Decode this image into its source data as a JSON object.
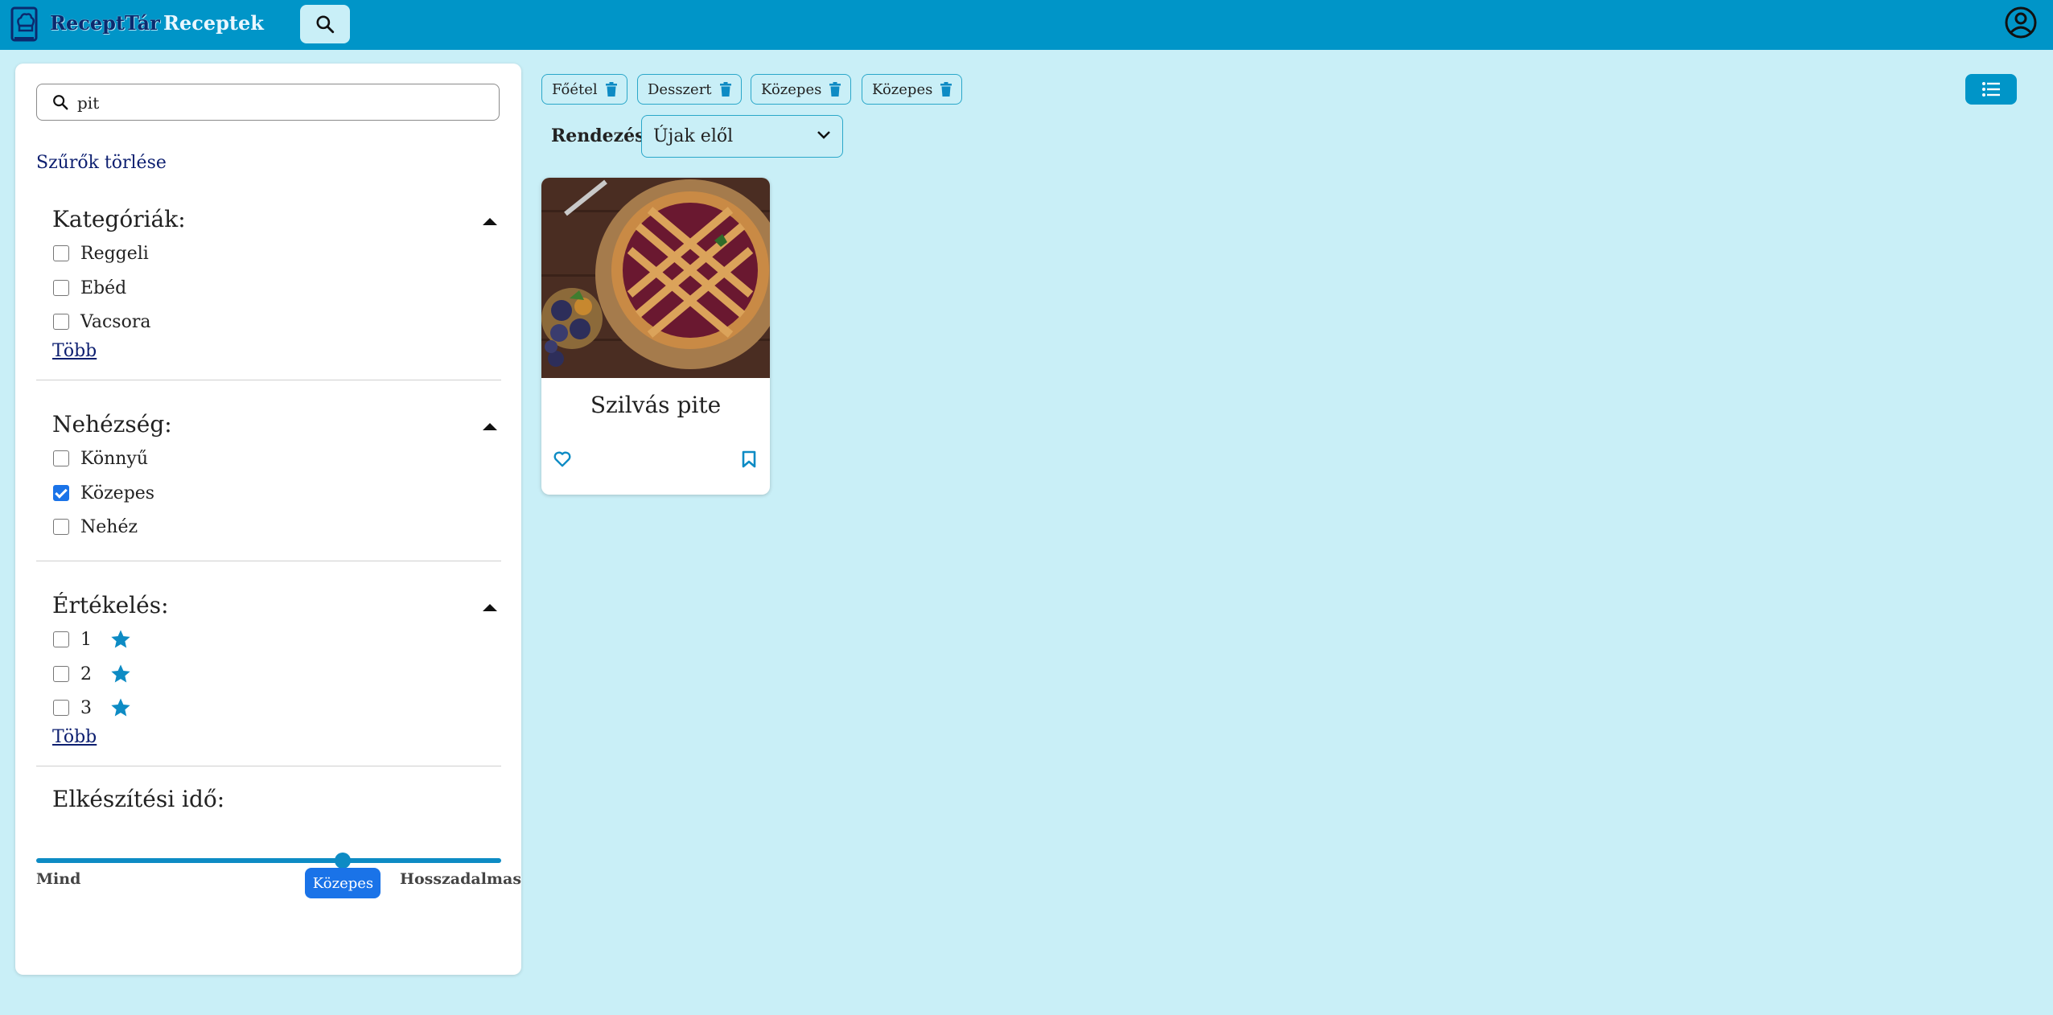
{
  "header": {
    "brand": "ReceptTár",
    "nav_recipes": "Receptek"
  },
  "sidebar": {
    "search": {
      "value": "pit"
    },
    "clear_filters": "Szűrők törlése",
    "categories": {
      "title": "Kategóriák:",
      "options": [
        {
          "label": "Reggeli",
          "checked": false
        },
        {
          "label": "Ebéd",
          "checked": false
        },
        {
          "label": "Vacsora",
          "checked": false
        }
      ],
      "more": "Több"
    },
    "difficulty": {
      "title": "Nehézség:",
      "options": [
        {
          "label": "Könnyű",
          "checked": false
        },
        {
          "label": "Közepes",
          "checked": true
        },
        {
          "label": "Nehéz",
          "checked": false
        }
      ]
    },
    "rating": {
      "title": "Értékelés:",
      "options": [
        {
          "label": "1",
          "checked": false
        },
        {
          "label": "2",
          "checked": false
        },
        {
          "label": "3",
          "checked": false
        }
      ],
      "more": "Több"
    },
    "prep_time": {
      "title": "Elkészítési idő:",
      "min_label": "Mind",
      "max_label": "Hosszadalmas",
      "value_label": "Közepes",
      "value_fraction": 0.66
    }
  },
  "filters": {
    "chips": [
      "Főétel",
      "Desszert",
      "Közepes",
      "Közepes"
    ]
  },
  "sort": {
    "label": "Rendezés:",
    "selected": "Újak elől"
  },
  "recipes": [
    {
      "title": "Szilvás pite"
    }
  ],
  "colors": {
    "topbar": "#0095c8",
    "background": "#c9eff7",
    "accent": "#0d8bc4",
    "checkbox": "#1a73e8"
  }
}
